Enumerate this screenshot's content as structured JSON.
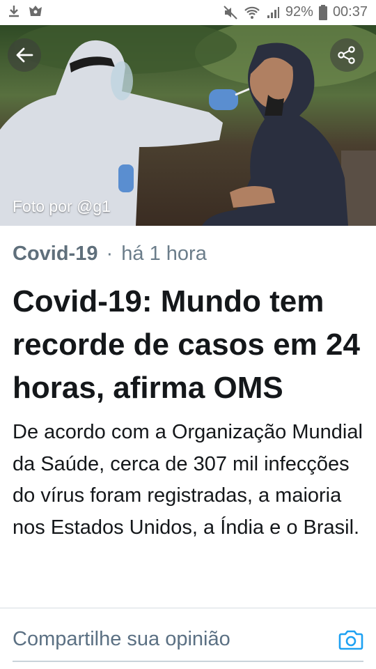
{
  "statusbar": {
    "battery": "92%",
    "time": "00:37"
  },
  "hero": {
    "photo_credit": "Foto por @g1"
  },
  "article": {
    "category": "Covid-19",
    "separator": "·",
    "time_ago": "há 1 hora",
    "headline": "Covid-19: Mundo tem recorde de casos em 24 horas, afirma OMS",
    "summary": "De acordo com a Organização Mundial da Saúde, cerca de 307 mil infecções do vírus foram registradas, a maioria nos Estados Unidos, a Índia e o Brasil."
  },
  "composer": {
    "placeholder": "Compartilhe sua opinião"
  },
  "colors": {
    "text": "#14171a",
    "meta": "#5f6f7b",
    "accent": "#1da1f2"
  },
  "icons": [
    "download-icon",
    "app-icon",
    "mute-icon",
    "wifi-icon",
    "signal-icon",
    "battery-icon",
    "back-arrow-icon",
    "share-icon",
    "camera-icon"
  ]
}
